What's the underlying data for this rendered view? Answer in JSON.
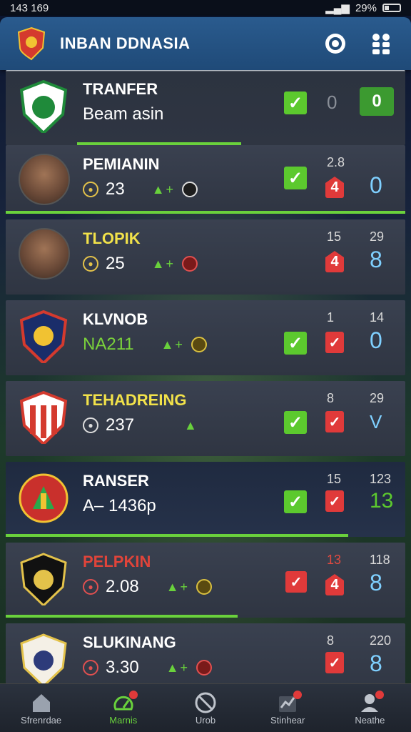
{
  "status": {
    "time": "143 169",
    "battery": "29%"
  },
  "header": {
    "title": "INBAN DDNASIA"
  },
  "rows": [
    {
      "name": "TRANFER",
      "sub": "Beam asin",
      "right_button": "0",
      "muted": "0"
    },
    {
      "name": "PEMIANIN",
      "sub_value": "23",
      "top": "2.8",
      "red": "4",
      "big": "0"
    },
    {
      "name": "TLOPIK",
      "sub_value": "25",
      "top1": "15",
      "top2": "29",
      "red": "4",
      "big": "8"
    },
    {
      "name": "KLVNOB",
      "sub_value": "NA211",
      "top1": "1",
      "top2": "14",
      "big": "0"
    },
    {
      "name": "TEHADREING",
      "sub_value": "237",
      "top1": "8",
      "top2": "29",
      "big": "V"
    },
    {
      "name": "RANSER",
      "sub_value": "A– 1436p",
      "top1": "15",
      "top2": "123",
      "big": "13"
    },
    {
      "name": "PELPKIN",
      "sub_value": "2.08",
      "top1": "13",
      "top2": "118",
      "red": "4",
      "big": "8"
    },
    {
      "name": "SLUKINANG",
      "sub_value": "3.30",
      "top1": "8",
      "top2": "220",
      "big": "8"
    }
  ],
  "nav": [
    {
      "label": "Sfrenrdae",
      "icon": "home-icon"
    },
    {
      "label": "Marnis",
      "icon": "gauge-icon"
    },
    {
      "label": "Urob",
      "icon": "ban-icon"
    },
    {
      "label": "Stinhear",
      "icon": "chart-icon"
    },
    {
      "label": "Neathe",
      "icon": "profile-icon"
    }
  ]
}
